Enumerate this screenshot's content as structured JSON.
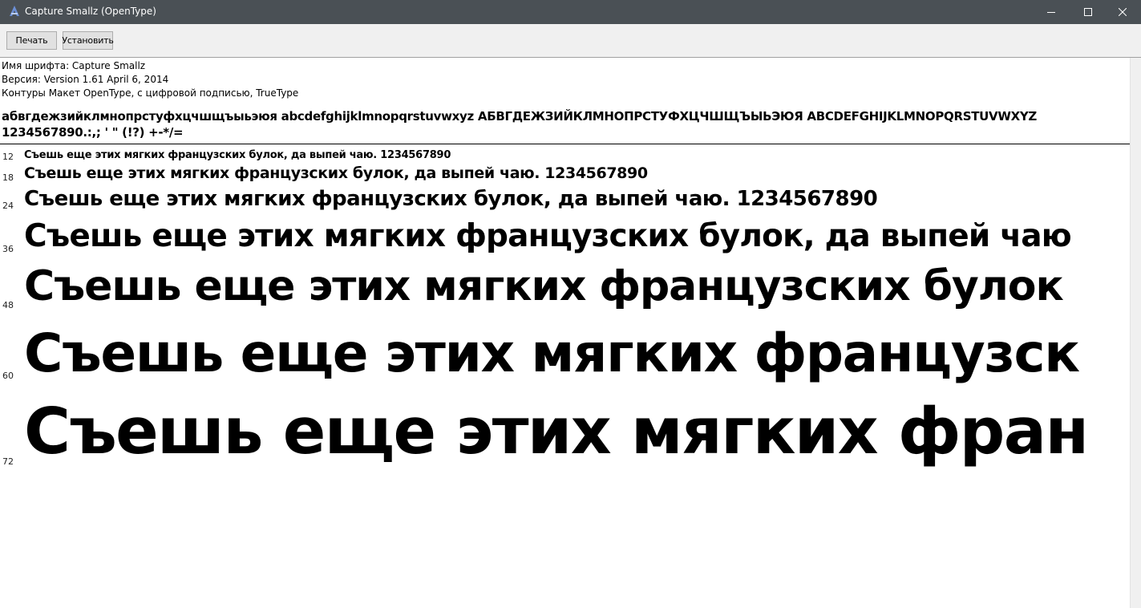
{
  "window": {
    "title": "Capture Smallz (OpenType)",
    "titlebar_color": "#4a5055"
  },
  "toolbar": {
    "print_label": "Печать",
    "install_label": "Установить"
  },
  "info": {
    "font_name": "Имя шрифта: Capture Smallz",
    "version": "Версия: Version 1.61 April 6, 2014",
    "outlines": "Контуры Макет OpenType, с цифровой подписью, TrueType"
  },
  "charset": {
    "line1": "абвгдежзийклмнопрстуфхцчшщъыьэюя abcdefghijklmnopqrstuvwxyz АБВГДЕЖЗИЙКЛМНОПРСТУФХЦЧШЩЪЫЬЭЮЯ ABCDEFGHIJKLMNOPQRSTUVWXYZ",
    "line2": "1234567890.:,; ' \" (!?) +-*/="
  },
  "samples": [
    {
      "size": "12",
      "text": "Съешь еще этих мягких французских булок, да выпей чаю. 1234567890"
    },
    {
      "size": "18",
      "text": "Съешь еще этих мягких французских булок, да выпей чаю. 1234567890"
    },
    {
      "size": "24",
      "text": "Съешь еще этих мягких французских булок, да выпей чаю. 1234567890"
    },
    {
      "size": "36",
      "text": "Съешь еще этих мягких французских булок, да выпей чаю"
    },
    {
      "size": "48",
      "text": "Съешь еще этих мягких французских булок"
    },
    {
      "size": "60",
      "text": "Съешь еще этих мягких французск"
    },
    {
      "size": "72",
      "text": "Съешь еще этих мягких фран"
    }
  ],
  "icons": {
    "app": "font-viewer-icon",
    "minimize": "minimize-icon",
    "maximize": "maximize-icon",
    "close": "close-icon"
  }
}
